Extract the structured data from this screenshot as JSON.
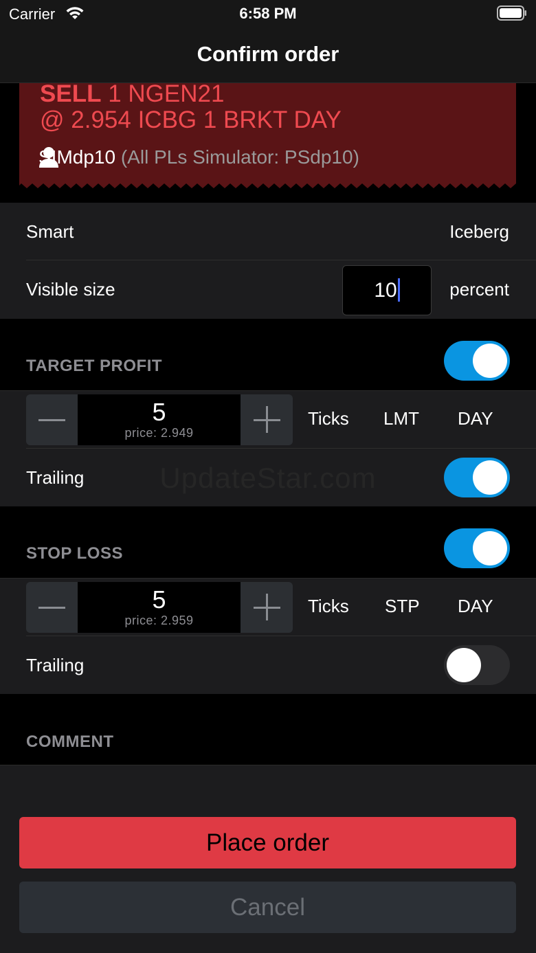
{
  "status_bar": {
    "carrier": "Carrier",
    "time": "6:58 PM"
  },
  "nav": {
    "title": "Confirm order"
  },
  "ticket": {
    "side": "SELL",
    "instrument": "1 NGEN21",
    "line2": "@ 2.954 ICBG 1 BRKT DAY",
    "account_name": "SIMdp10",
    "account_detail": "(All PLs Simulator: PSdp10)"
  },
  "order_settings": {
    "smart_label": "Smart",
    "smart_value": "Iceberg",
    "visible_size_label": "Visible size",
    "visible_size_value": "10",
    "visible_size_unit": "percent"
  },
  "target_profit": {
    "title": "TARGET PROFIT",
    "enabled": true,
    "ticks_value": "5",
    "price_text": "price: 2.949",
    "unit": "Ticks",
    "order_type": "LMT",
    "duration": "DAY",
    "trailing_label": "Trailing",
    "trailing_enabled": true
  },
  "stop_loss": {
    "title": "STOP LOSS",
    "enabled": true,
    "ticks_value": "5",
    "price_text": "price: 2.959",
    "unit": "Ticks",
    "order_type": "STP",
    "duration": "DAY",
    "trailing_label": "Trailing",
    "trailing_enabled": false
  },
  "comment": {
    "title": "COMMENT",
    "value": ""
  },
  "watermark": "UpdateStar.com",
  "actions": {
    "place_label": "Place order",
    "cancel_label": "Cancel"
  },
  "colors": {
    "sell_red": "#ef4a50",
    "ticket_bg": "#5a1416",
    "toggle_on": "#0a95e1",
    "place_button": "#df3a44",
    "cancel_button": "#2c3036"
  }
}
